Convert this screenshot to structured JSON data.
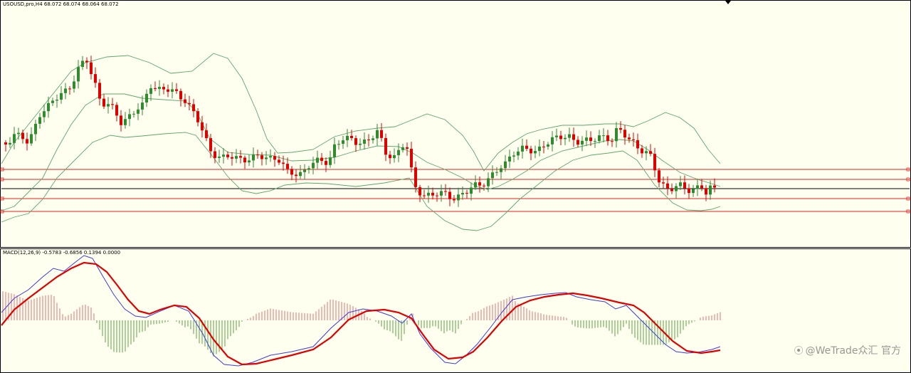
{
  "price_pane": {
    "title": "USOUSD,pro,H4 68.072 68.074 68.064 68.072"
  },
  "macd_pane": {
    "title": "MACD(12,26,9) -0.5783 -0.6856 0.1394 0.0000"
  },
  "watermark": {
    "icon": "wetrade-logo-icon",
    "text": "@WeTrade众汇 官方"
  },
  "colors": {
    "background": "#fffff0",
    "bull_candle": "#2e8b2e",
    "bear_candle": "#e10000",
    "bollinger": "#5aa86a",
    "level_line": "#e02020",
    "current_price_line": "#000000",
    "macd_line": "#3a3ae0",
    "signal_line": "#e00000",
    "hist_positive": "#e07070",
    "hist_negative": "#5aa040"
  },
  "chart_data": [
    {
      "type": "candlestick",
      "symbol": "USOUSD,pro",
      "timeframe": "H4",
      "ohlc_readout": {
        "open": 68.072,
        "high": 68.074,
        "low": 68.064,
        "close": 68.072
      },
      "indicators": [
        "Bollinger Bands",
        "Horizontal levels"
      ],
      "grid": false
    },
    {
      "type": "line",
      "indicator": "MACD",
      "params": [
        12,
        26,
        9
      ],
      "readout": [
        -0.5783,
        -0.6856,
        0.1394,
        0.0
      ],
      "series": [
        {
          "role": "macd"
        },
        {
          "role": "signal"
        },
        {
          "role": "histogram"
        }
      ],
      "grid": false
    }
  ]
}
